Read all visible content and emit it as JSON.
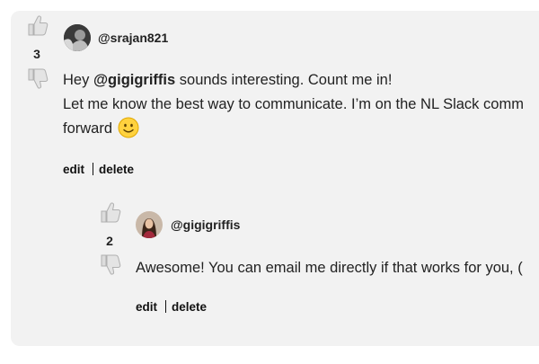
{
  "comments": [
    {
      "username": "@srajan821",
      "votes": "3",
      "text_pre": "Hey ",
      "mention": "@gigigriffis",
      "text_post": " sounds interesting. Count me in!",
      "line2": "Let me know the best way to communicate. I’m on the NL Slack comm",
      "line3": "forward",
      "emoji": "slightly-smiling-face",
      "edit_label": "edit",
      "delete_label": "delete"
    },
    {
      "username": "@gigigriffis",
      "votes": "2",
      "text": "Awesome! You can email me directly if that works for you, (",
      "edit_label": "edit",
      "delete_label": "delete"
    }
  ],
  "icons": {
    "upvote": "thumbs-up-icon",
    "downvote": "thumbs-down-icon"
  },
  "colors": {
    "card_background": "#f2f2f2",
    "text": "#222222"
  }
}
